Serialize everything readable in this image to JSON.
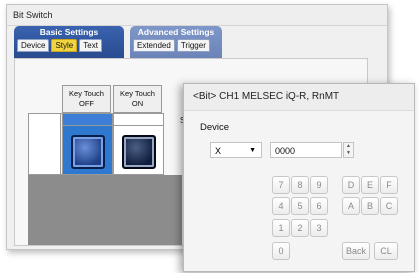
{
  "back_window": {
    "title": "Bit Switch",
    "tab_groups": [
      {
        "label": "Basic Settings",
        "tabs": [
          "Device",
          "Style",
          "Text"
        ],
        "active": "Style"
      },
      {
        "label": "Advanced Settings",
        "tabs": [
          "Extended",
          "Trigger"
        ]
      }
    ],
    "key_touch_off": "Key Touch\nOFF",
    "key_touch_on": "Key Touch\nON",
    "cut_label": "S"
  },
  "dialog": {
    "title": "<Bit> CH1 MELSEC iQ-R, RnMT",
    "device_label": "Device",
    "device_type": "X",
    "device_number": "0000",
    "keypad": {
      "row1": [
        "7",
        "8",
        "9"
      ],
      "row2": [
        "4",
        "5",
        "6"
      ],
      "row3": [
        "1",
        "2",
        "3"
      ],
      "row4": [
        "0"
      ],
      "hex_row1": [
        "D",
        "E",
        "F"
      ],
      "hex_row2": [
        "A",
        "B",
        "C"
      ],
      "back": "Back",
      "clear": "CL"
    }
  },
  "icons": [
    "dropdown-caret-icon",
    "spin-up-icon",
    "spin-down-icon"
  ]
}
